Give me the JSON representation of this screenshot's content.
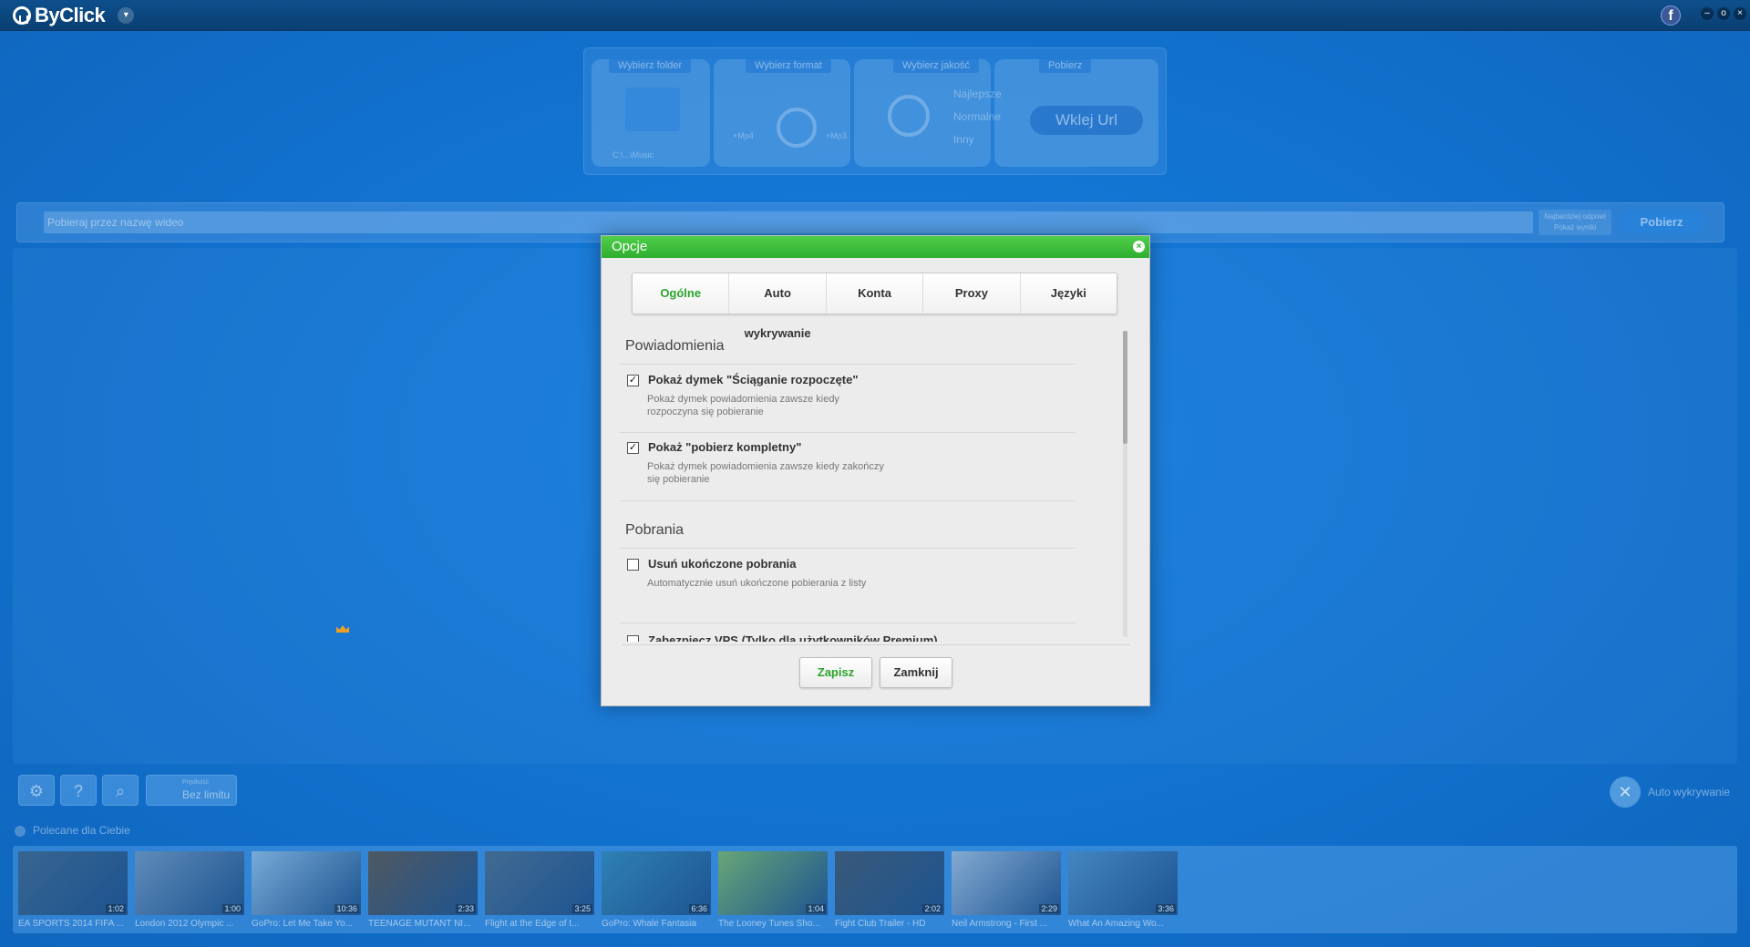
{
  "app": {
    "name": "ByClick"
  },
  "titlebar": {
    "facebook_label": "f",
    "dropdown_glyph": "▾",
    "minimize_glyph": "–",
    "restore_glyph": "o",
    "close_glyph": "×"
  },
  "top_panel": {
    "folder_label": "Wybierz folder",
    "folder_path": "C:\\...\\Music",
    "format_label": "Wybierz format",
    "format_mp4": "+Mp4",
    "format_mp3": "+Mp3",
    "quality_label": "Wybierz jakość",
    "quality_options": [
      "Najlepsze",
      "Normalne",
      "Inny"
    ],
    "download_label": "Pobierz",
    "paste_url": "Wklej Url"
  },
  "search": {
    "placeholder": "Pobieraj przez nazwę wideo",
    "option_line1": "Najbardziej odpowi",
    "option_line2": "Pokaż wyniki",
    "button": "Pobierz"
  },
  "toolbar": {
    "speed_label": "Prędkość",
    "speed_value": "Bez limitu",
    "auto_detect": "Auto wykrywanie",
    "settings_glyph": "⚙",
    "help_glyph": "?",
    "search_glyph": "⌕"
  },
  "recommended": {
    "header": "Polecane dla Ciebie",
    "items": [
      {
        "title": "EA SPORTS 2014 FIFA ...",
        "duration": "1:02",
        "color": "#3a5c7a"
      },
      {
        "title": "London 2012 Olympic ...",
        "duration": "1:00",
        "color": "#6f8fb0"
      },
      {
        "title": "GoPro: Let Me Take Yo...",
        "duration": "10:36",
        "color": "#8fb7d8"
      },
      {
        "title": "TEENAGE MUTANT NI...",
        "duration": "2:33",
        "color": "#5a4a3a"
      },
      {
        "title": "Flight at the Edge of t...",
        "duration": "3:25",
        "color": "#46617a"
      },
      {
        "title": "GoPro: Whale Fantasia",
        "duration": "6:36",
        "color": "#2e7fa8"
      },
      {
        "title": "The Looney Tunes Sho...",
        "duration": "1:04",
        "color": "#7ab055"
      },
      {
        "title": "Fight Club Trailer - HD",
        "duration": "2:02",
        "color": "#3c4a58"
      },
      {
        "title": "Neil Armstrong - First ...",
        "duration": "2:29",
        "color": "#9fb7d0"
      },
      {
        "title": "What An Amazing Wo...",
        "duration": "3:36",
        "color": "#4a86b8"
      }
    ]
  },
  "dialog": {
    "title": "Opcje",
    "close_glyph": "×",
    "tabs": [
      "Ogólne",
      "Auto wykrywanie",
      "Konta",
      "Proxy",
      "Języki"
    ],
    "sections": [
      {
        "heading": "Powiadomienia",
        "options": [
          {
            "title": "Pokaż dymek \"Ściąganie rozpoczęte\"",
            "desc": "Pokaż dymek powiadomienia zawsze kiedy rozpoczyna się pobieranie",
            "checked": true
          },
          {
            "title": "Pokaż \"pobierz kompletny\"",
            "desc": "Pokaż dymek powiadomienia zawsze kiedy zakończy się pobieranie",
            "checked": true
          }
        ]
      },
      {
        "heading": "Pobrania",
        "options": [
          {
            "title": "Usuń ukończone pobrania",
            "desc": "Automatycznie usuń ukończone pobierania z listy",
            "checked": false
          },
          {
            "title": "Zabezpiecz VPS (Tylko dla użytkowników Premium)",
            "desc": "",
            "checked": false
          }
        ]
      }
    ],
    "save_button": "Zapisz",
    "close_button": "Zamknij"
  },
  "check_glyph": "✓"
}
